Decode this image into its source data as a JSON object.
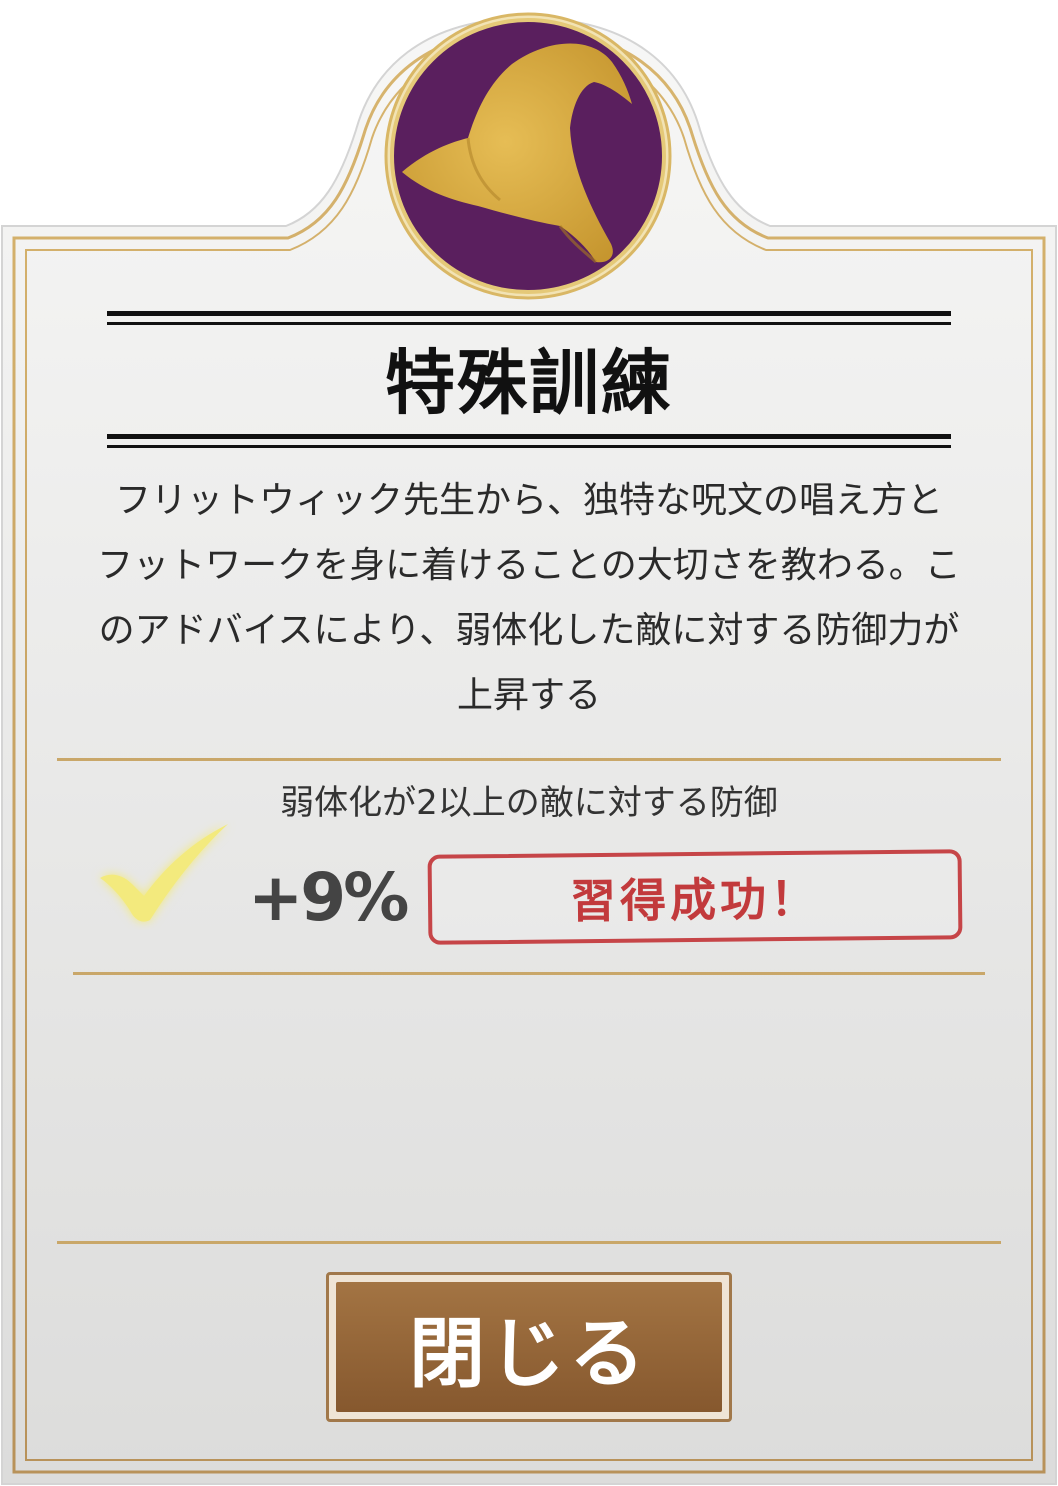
{
  "emblem": {
    "icon": "wizard-hat-icon",
    "background_color": "#5a1f5e",
    "icon_color": "#d9ad3f",
    "ring_color": "#e5c978"
  },
  "card": {
    "title": "特殊訓練",
    "description_lines": [
      "フリットウィック先生から、独特な呪文の唱え方と",
      "フットワークを身に着けることの大切さを教わる。こ",
      "のアドバイスにより、弱体化した敵に対する防御力が",
      "上昇する"
    ],
    "border_color": "#c9a769"
  },
  "stat": {
    "label": "弱体化が2以上の敵に対する防御",
    "value": "+9%",
    "check_icon": "check-icon",
    "check_color": "#f3ea7d"
  },
  "result": {
    "label": "習得成功！",
    "color": "#c23a3c"
  },
  "close_button": {
    "label": "閉じる",
    "color": "#966638"
  }
}
